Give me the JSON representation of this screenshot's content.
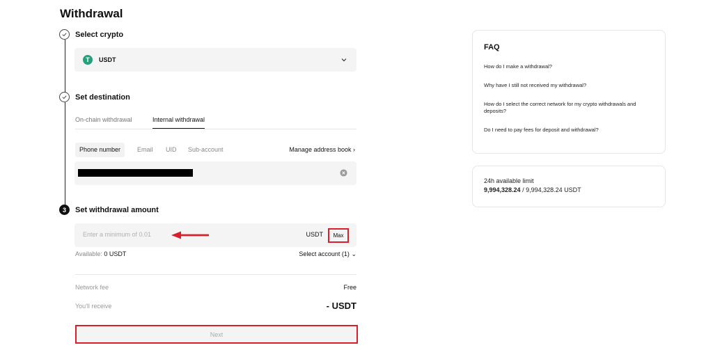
{
  "page": {
    "title": "Withdrawal"
  },
  "steps": {
    "step1": {
      "title": "Select crypto"
    },
    "step2": {
      "title": "Set destination"
    },
    "step3": {
      "number": "3",
      "title": "Set withdrawal amount"
    }
  },
  "crypto_select": {
    "icon_letter": "T",
    "value": "USDT"
  },
  "destination": {
    "tabs": [
      {
        "label": "On-chain withdrawal",
        "active": false
      },
      {
        "label": "Internal withdrawal",
        "active": true
      }
    ],
    "subtabs": [
      {
        "label": "Phone number",
        "active": true
      },
      {
        "label": "Email",
        "active": false
      },
      {
        "label": "UID",
        "active": false
      },
      {
        "label": "Sub-account",
        "active": false
      }
    ],
    "manage_label": "Manage address book",
    "manage_chevron": "›"
  },
  "amount": {
    "placeholder": "Enter a minimum of 0.01",
    "unit": "USDT",
    "max_label": "Max",
    "available_label": "Available:",
    "available_value": "0 USDT",
    "select_account": "Select account (1)",
    "select_chevron": "⌄"
  },
  "summary": {
    "fee_label": "Network fee",
    "fee_value": "Free",
    "receive_label": "You'll receive",
    "receive_value": "- USDT"
  },
  "next_button": {
    "label": "Next"
  },
  "faq": {
    "title": "FAQ",
    "items": [
      "How do I make a withdrawal?",
      "Why have I still not received my withdrawal?",
      "How do I select the correct network for my crypto withdrawals and deposits?",
      "Do I need to pay fees for deposit and withdrawal?"
    ]
  },
  "limit": {
    "label": "24h available limit",
    "available": "9,994,328.24",
    "separator": "/",
    "total": "9,994,328.24 USDT"
  },
  "colors": {
    "annotation_red": "#d8202a",
    "usdt_green": "#26a17b",
    "input_bg": "#f4f4f4"
  }
}
